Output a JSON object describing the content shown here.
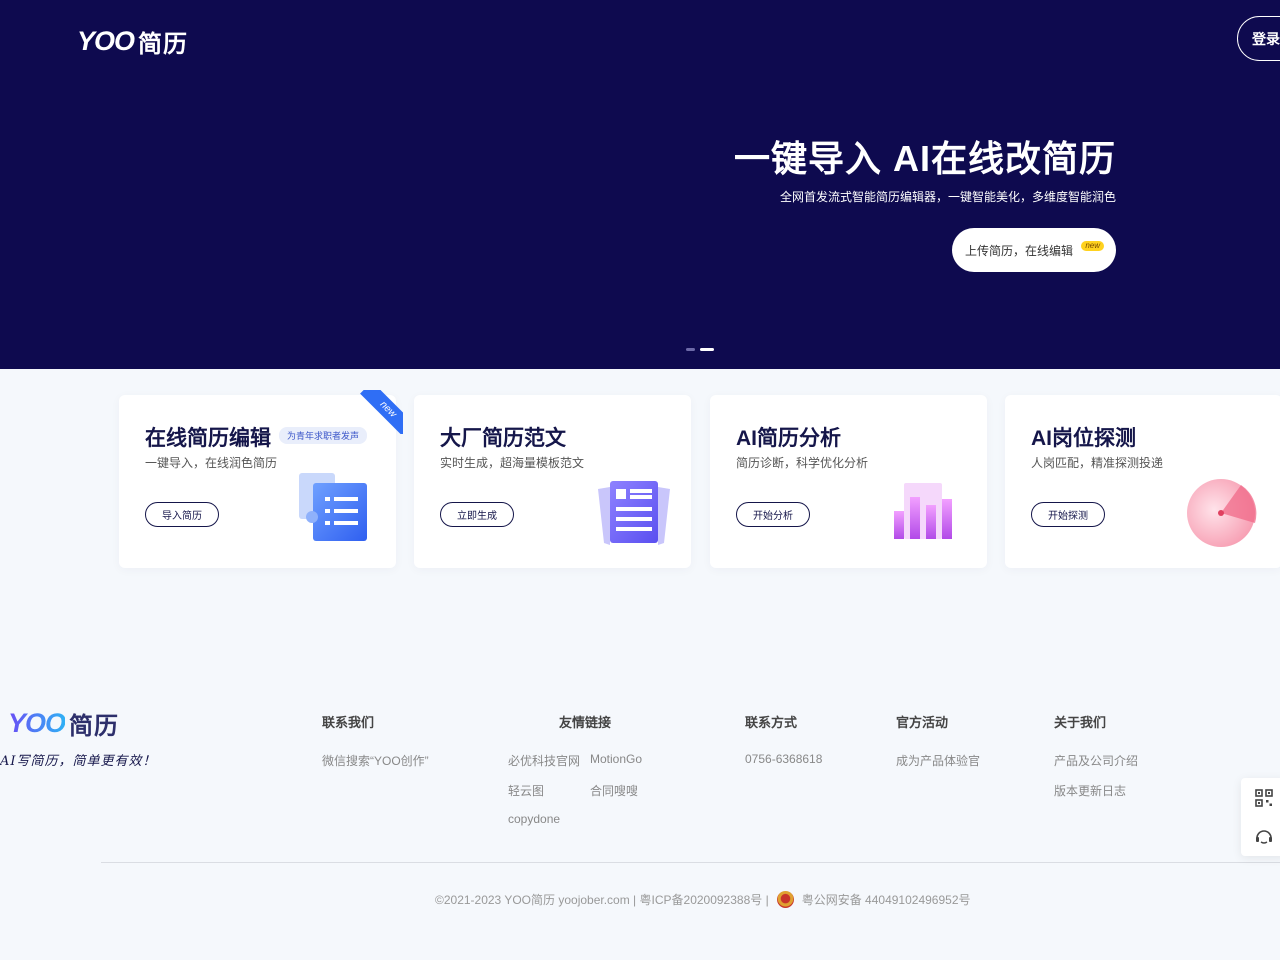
{
  "header": {
    "logo_text": "YOO",
    "logo_cn": "简历",
    "login_label": "登录"
  },
  "hero": {
    "title": "一键导入 AI在线改简历",
    "subtitle": "全网首发流式智能简历编辑器，一键智能美化，多维度智能润色",
    "cta_label": "上传简历，在线编辑",
    "cta_badge": "new",
    "carousel": {
      "count": 2,
      "active_index": 1
    }
  },
  "cards": [
    {
      "title": "在线简历编辑",
      "tag": "为青年求职者发声",
      "desc": "一键导入，在线润色简历",
      "button": "导入简历",
      "ribbon": "new",
      "icon": "document-list-icon"
    },
    {
      "title": "大厂简历范文",
      "desc": "实时生成，超海量模板范文",
      "button": "立即生成",
      "icon": "resume-template-icon"
    },
    {
      "title": "AI简历分析",
      "desc": "简历诊断，科学优化分析",
      "button": "开始分析",
      "icon": "bar-chart-icon"
    },
    {
      "title": "AI岗位探测",
      "desc": "人岗匹配，精准探测投递",
      "button": "开始探测",
      "icon": "radar-icon"
    }
  ],
  "footer": {
    "logo_text": "YOO",
    "logo_cn": "简历",
    "slogan": "AI写简历，简单更有效！",
    "columns": {
      "contact_us": {
        "title": "联系我们",
        "items": [
          "微信搜索“YOO创作”"
        ]
      },
      "friend_links": {
        "title": "友情链接",
        "items": [
          "必优科技官网",
          "MotionGo",
          "轻云图",
          "合同嗖嗖",
          "copydone"
        ]
      },
      "contact": {
        "title": "联系方式",
        "items": [
          "0756-6368618"
        ]
      },
      "activities": {
        "title": "官方活动",
        "items": [
          "成为产品体验官"
        ]
      },
      "about": {
        "title": "关于我们",
        "items": [
          "产品及公司介绍",
          "版本更新日志"
        ]
      }
    },
    "copyright": "©2021-2023 YOO简历 yoojober.com | 粤ICP备2020092388号 |",
    "police": "粤公网安备 44049102496952号"
  },
  "side_float": {
    "items": [
      "qr-code-icon",
      "customer-service-icon"
    ]
  },
  "colors": {
    "hero_bg": "#0e0a4f",
    "accent": "#2f6ef5",
    "title_dark": "#15164a",
    "badge": "#ffd21f"
  }
}
